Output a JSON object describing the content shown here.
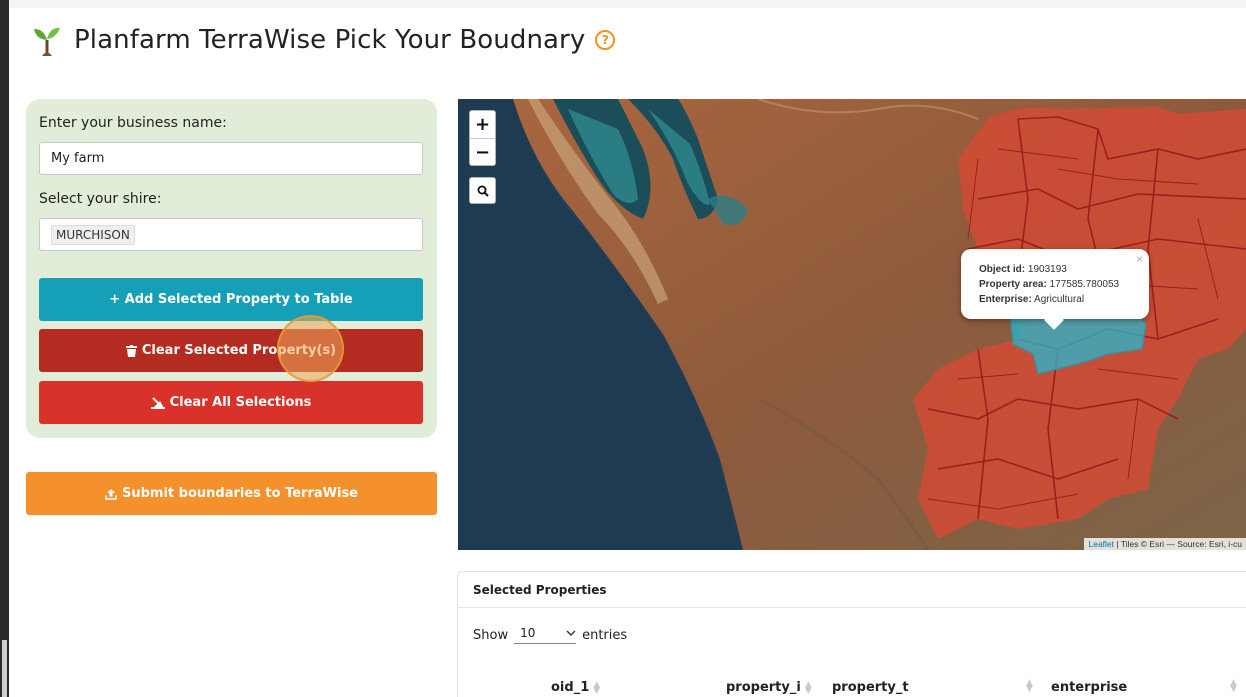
{
  "header": {
    "title": "Planfarm TerraWise Pick Your Boudnary",
    "help_icon": "question-circle-icon",
    "logo_icon": "seedling-icon"
  },
  "form": {
    "business_label": "Enter your business name:",
    "business_value": "My farm",
    "shire_label": "Select your shire:",
    "shire_value": "MURCHISON"
  },
  "buttons": {
    "add": "+ Add Selected Property to Table",
    "clear_selected": "Clear Selected Property(s)",
    "clear_all": "Clear All Selections",
    "submit": "Submit boundaries to TerraWise"
  },
  "map": {
    "zoom_in": "+",
    "zoom_out": "−",
    "popup": {
      "object_id_label": "Object id:",
      "object_id": "1903193",
      "area_label": "Property area:",
      "area": "177585.780053",
      "enterprise_label": "Enterprise:",
      "enterprise": "Agricultural",
      "close": "×"
    },
    "attribution_link": "Leaflet",
    "attribution_text": "| Tiles © Esri — Source: Esri, i-cu"
  },
  "table": {
    "title": "Selected Properties",
    "show_label": "Show",
    "page_size": "10",
    "entries_label": "entries",
    "columns": [
      "oid_1",
      "property_i",
      "property_t",
      "enterprise"
    ]
  },
  "colors": {
    "panel_bg": "#e1ecd9",
    "add_button": "#16a0b7",
    "clear_button": "#b42b22",
    "clear_all_button": "#d9322a",
    "submit_button": "#f4912d"
  }
}
